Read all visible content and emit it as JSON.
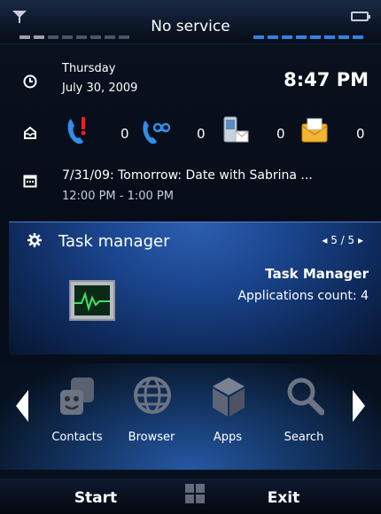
{
  "status": {
    "title": "No service"
  },
  "today": {
    "day": "Thursday",
    "date": "July 30, 2009",
    "time": "8:47 PM"
  },
  "counts": [
    {
      "icon": "missed-call-icon",
      "value": "0"
    },
    {
      "icon": "voicemail-icon",
      "value": "0"
    },
    {
      "icon": "text-message-icon",
      "value": "0"
    },
    {
      "icon": "email-icon",
      "value": "0"
    }
  ],
  "appointment": {
    "title": "7/31/09: Tomorrow: Date with Sabrina ...",
    "time": "12:00 PM - 1:00 PM"
  },
  "task_panel": {
    "title": "Task manager",
    "pager": "5 / 5",
    "heading": "Task Manager",
    "count_text": "Applications count: 4"
  },
  "apps": [
    {
      "label": "Contacts",
      "icon": "contacts-icon"
    },
    {
      "label": "Browser",
      "icon": "globe-icon"
    },
    {
      "label": "Apps",
      "icon": "cube-icon"
    },
    {
      "label": "Search",
      "icon": "magnifier-icon"
    }
  ],
  "softkeys": {
    "left": "Start",
    "right": "Exit"
  },
  "colors": {
    "accent": "#2f83e6",
    "panel": "#1b468f"
  }
}
